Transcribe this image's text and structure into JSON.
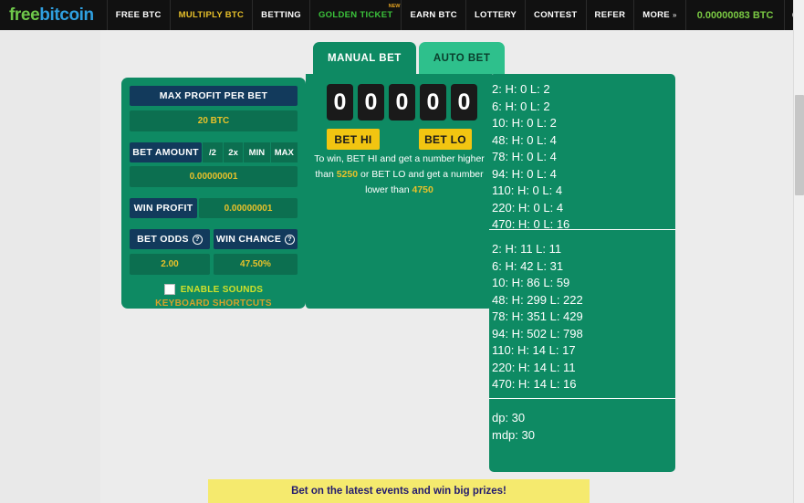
{
  "nav": {
    "logo_free": "free",
    "logo_bitcoin": "bitcoin",
    "items": [
      {
        "label": "FREE BTC",
        "state": "normal"
      },
      {
        "label": "MULTIPLY BTC",
        "state": "active"
      },
      {
        "label": "BETTING",
        "state": "normal"
      },
      {
        "label": "GOLDEN TICKET",
        "state": "golden",
        "badge": "NEW"
      },
      {
        "label": "EARN BTC",
        "state": "normal"
      },
      {
        "label": "LOTTERY",
        "state": "normal"
      },
      {
        "label": "CONTEST",
        "state": "normal"
      },
      {
        "label": "REFER",
        "state": "normal"
      },
      {
        "label": "MORE",
        "state": "normal",
        "chevron": "»"
      }
    ],
    "balance": "0.00000083 BTC",
    "power_icon": "power-icon"
  },
  "tabs": {
    "manual": "MANUAL BET",
    "auto": "AUTO BET"
  },
  "left_panel": {
    "max_profit_label": "MAX PROFIT PER BET",
    "max_profit_value": "20 BTC",
    "bet_amount_label": "BET AMOUNT",
    "bet_amount_buttons": [
      "/2",
      "2x",
      "MIN",
      "MAX"
    ],
    "bet_amount_value": "0.00000001",
    "win_profit_label": "WIN PROFIT",
    "win_profit_value": "0.00000001",
    "bet_odds_label": "BET ODDS",
    "bet_odds_value": "2.00",
    "win_chance_label": "WIN CHANCE",
    "win_chance_value": "47.50%",
    "help_glyph": "?",
    "enable_sounds": "ENABLE SOUNDS",
    "keyboard_shortcuts": "KEYBOARD SHORTCUTS"
  },
  "bet_area": {
    "digits": [
      "0",
      "0",
      "0",
      "0",
      "0"
    ],
    "bet_hi": "BET HI",
    "bet_lo": "BET LO",
    "win_text_1": "To win, BET HI and get a number higher than ",
    "win_hi_threshold": "5250",
    "win_text_2": " or BET LO and get a number lower than ",
    "win_lo_threshold": "4750"
  },
  "stats": {
    "section1": [
      "2: H: 0 L: 2",
      "6: H: 0 L: 2",
      "10: H: 0 L: 2",
      "48: H: 0 L: 4",
      "78: H: 0 L: 4",
      "94: H: 0 L: 4",
      "110: H: 0 L: 4",
      "220: H: 0 L: 4",
      "470: H: 0 L: 16"
    ],
    "section2": [
      "2: H: 11 L: 11",
      "6: H: 42 L: 31",
      "10: H: 86 L: 59",
      "48: H: 299 L: 222",
      "78: H: 351 L: 429",
      "94: H: 502 L: 798",
      "110: H: 14 L: 17",
      "220: H: 14 L: 11",
      "470: H: 14 L: 16"
    ],
    "section3": [
      "dp: 30",
      "mdp: 30"
    ]
  },
  "banner": {
    "text": "Bet on the latest events and win big prizes!"
  },
  "colors": {
    "green_panel": "#0e8a63",
    "green_inner": "#0c6f50",
    "navy_label": "#123a5c",
    "gold": "#e8c12a",
    "yellow_button": "#f2c511",
    "banner_bg": "#f5ea6e",
    "banner_text": "#221a6e"
  }
}
